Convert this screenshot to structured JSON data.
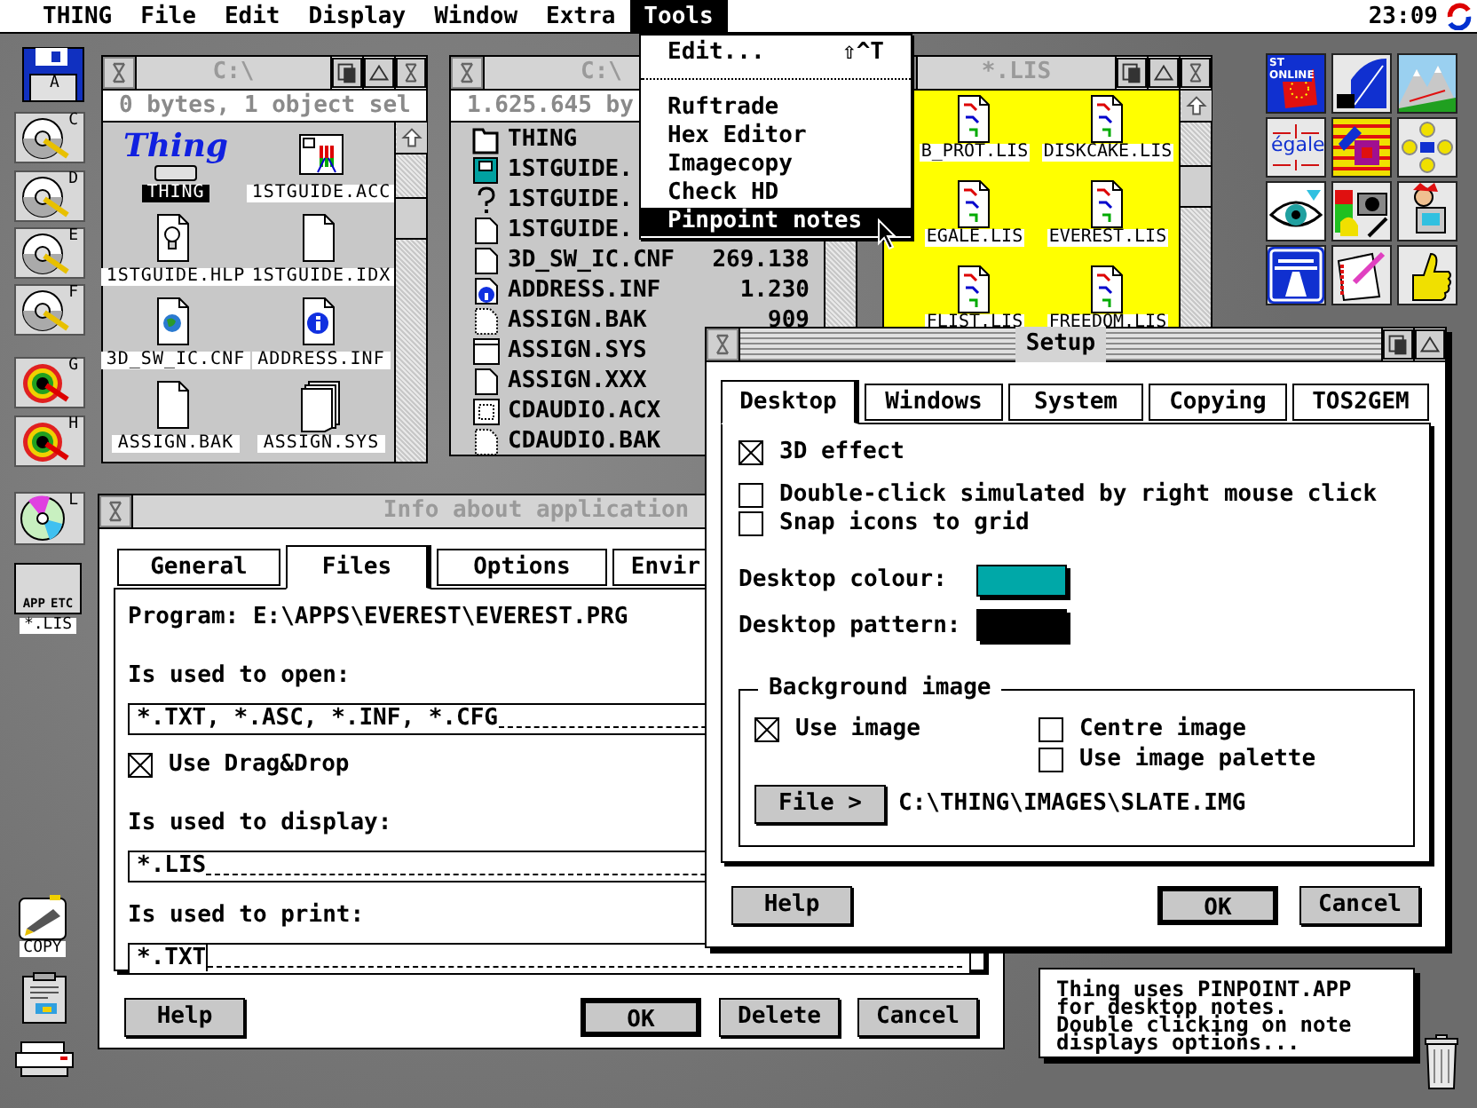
{
  "menu_bar": {
    "items": [
      {
        "label": "THING",
        "selected": false
      },
      {
        "label": "File",
        "selected": false
      },
      {
        "label": "Edit",
        "selected": false
      },
      {
        "label": "Display",
        "selected": false
      },
      {
        "label": "Window",
        "selected": false
      },
      {
        "label": "Extra",
        "selected": false
      },
      {
        "label": "Tools",
        "selected": true
      }
    ],
    "clock": "23:09"
  },
  "tools_menu": {
    "items": [
      {
        "label": "Edit...",
        "shortcut": "⇧^T",
        "selected": false,
        "separator_after": true
      },
      {
        "label": "Ruftrade",
        "selected": false,
        "separator_after": false
      },
      {
        "label": "Hex Editor",
        "selected": false,
        "separator_after": false
      },
      {
        "label": "Imagecopy",
        "selected": false,
        "separator_after": false
      },
      {
        "label": "Check HD",
        "selected": false,
        "separator_after": false
      },
      {
        "label": "Pinpoint notes",
        "selected": true,
        "separator_after": false
      }
    ]
  },
  "drives": [
    {
      "kind": "floppy",
      "letter": "A"
    },
    {
      "kind": "hard_disk",
      "letter": "C"
    },
    {
      "kind": "hard_disk",
      "letter": "D"
    },
    {
      "kind": "hard_disk",
      "letter": "E"
    },
    {
      "kind": "hard_disk",
      "letter": "F"
    },
    {
      "kind": "colour_disk",
      "letter": "G"
    },
    {
      "kind": "colour_disk",
      "letter": "H"
    },
    {
      "kind": "cd",
      "letter": "L"
    }
  ],
  "desktop_icons": [
    {
      "kind": "app_group",
      "label": "*.LIS",
      "caption": [
        "APP",
        "ETC"
      ]
    },
    {
      "kind": "copy",
      "label": "COPY"
    },
    {
      "kind": "clipboard"
    },
    {
      "kind": "printer"
    },
    {
      "kind": "trash"
    }
  ],
  "icon_window": {
    "title": "C:\\",
    "info": "0 bytes, 1 object sel",
    "items": [
      {
        "kind": "thing_logo",
        "label": "THING",
        "logo_text": "Thing",
        "selected": true
      },
      {
        "kind": "app",
        "label": "1STGUIDE.ACC",
        "selected": false
      },
      {
        "kind": "help_doc",
        "label": "1STGUIDE.HLP",
        "selected": false
      },
      {
        "kind": "doc",
        "label": "1STGUIDE.IDX",
        "selected": false
      },
      {
        "kind": "globe_doc",
        "label": "3D_SW_IC.CNF",
        "selected": false
      },
      {
        "kind": "info_doc",
        "label": "ADDRESS.INF",
        "selected": false
      },
      {
        "kind": "doc",
        "label": "ASSIGN.BAK",
        "selected": false
      },
      {
        "kind": "stack_doc",
        "label": "ASSIGN.SYS",
        "selected": false
      }
    ]
  },
  "list_window": {
    "title": "C:\\",
    "info": "1.625.645 by",
    "rows": [
      {
        "kind": "folder",
        "name": "THING"
      },
      {
        "kind": "app",
        "name": "1STGUIDE."
      },
      {
        "kind": "help",
        "name": "1STGUIDE."
      },
      {
        "kind": "doc",
        "name": "1STGUIDE."
      },
      {
        "kind": "doc",
        "name": "3D_SW_IC.CNF",
        "size": "269.138"
      },
      {
        "kind": "info",
        "name": "ADDRESS.INF",
        "size": "1.230"
      },
      {
        "kind": "dotted",
        "name": "ASSIGN.BAK",
        "size": "909"
      },
      {
        "kind": "window",
        "name": "ASSIGN.SYS"
      },
      {
        "kind": "doc",
        "name": "ASSIGN.XXX"
      },
      {
        "kind": "dotted_box",
        "name": "CDAUDIO.ACX"
      },
      {
        "kind": "dotted",
        "name": "CDAUDIO.BAK"
      }
    ]
  },
  "lis_window": {
    "title": "*.LIS",
    "items": [
      {
        "label": "B_PROT.LIS"
      },
      {
        "label": "DISKCAKE.LIS"
      },
      {
        "label": "EGALE.LIS"
      },
      {
        "label": "EVEREST.LIS"
      },
      {
        "label": "FLIST.LIS"
      },
      {
        "label": "FREEDOM.LIS"
      }
    ]
  },
  "app_icons": [
    {
      "kind": "st_online",
      "caption": "ST ONLINE"
    },
    {
      "kind": "building"
    },
    {
      "kind": "mountains"
    },
    {
      "kind": "egale",
      "caption": "égale"
    },
    {
      "kind": "puzzle"
    },
    {
      "kind": "rings"
    },
    {
      "kind": "eye"
    },
    {
      "kind": "camera"
    },
    {
      "kind": "jester"
    },
    {
      "kind": "road"
    },
    {
      "kind": "notebook"
    },
    {
      "kind": "thumb"
    }
  ],
  "info_dialog": {
    "title": "Info about application",
    "tabs": [
      {
        "label": "General",
        "selected": false
      },
      {
        "label": "Files",
        "selected": true
      },
      {
        "label": "Options",
        "selected": false
      },
      {
        "label": "Envir",
        "selected": false
      }
    ],
    "program": "Program: E:\\APPS\\EVEREST\\EVEREST.PRG",
    "fields": [
      {
        "label": "Is used to open:",
        "value": "*.TXT, *.ASC, *.INF, *.CFG",
        "focused": false
      },
      {
        "label": "Is used to display:",
        "value": "*.LIS",
        "focused": false
      },
      {
        "label": "Is used to print:",
        "value": "*.TXT",
        "focused": true
      }
    ],
    "drag_drop": {
      "label": "Use Drag&Drop",
      "checked": true
    },
    "buttons": [
      {
        "label": "Help",
        "default": false
      },
      {
        "label": "OK",
        "default": true
      },
      {
        "label": "Delete",
        "default": false
      },
      {
        "label": "Cancel",
        "default": false
      }
    ]
  },
  "setup_dialog": {
    "title": "Setup",
    "tabs": [
      {
        "label": "Desktop",
        "selected": true
      },
      {
        "label": "Windows",
        "selected": false
      },
      {
        "label": "System",
        "selected": false
      },
      {
        "label": "Copying",
        "selected": false
      },
      {
        "label": "TOS2GEM",
        "selected": false
      }
    ],
    "options": [
      {
        "label": "3D effect",
        "checked": true
      },
      {
        "label": "Double-click simulated by right mouse click",
        "checked": false
      },
      {
        "label": "Snap icons to grid",
        "checked": false
      }
    ],
    "swatches": [
      {
        "label": "Desktop colour:",
        "color": "#00a8a8"
      },
      {
        "label": "Desktop pattern:",
        "color": "#000000"
      }
    ],
    "background_image": {
      "title": "Background image",
      "options": [
        {
          "label": "Use image",
          "checked": true
        },
        {
          "label": "Centre image",
          "checked": false
        },
        {
          "label": "Use image palette",
          "checked": false
        }
      ],
      "file_button": "File >",
      "path": "C:\\THING\\IMAGES\\SLATE.IMG"
    },
    "buttons": [
      {
        "label": "Help",
        "default": false
      },
      {
        "label": "OK",
        "default": true
      },
      {
        "label": "Cancel",
        "default": false
      }
    ]
  },
  "note": "Thing uses PINPOINT.APP\nfor desktop notes.\nDouble clicking on note\ndisplays options..."
}
